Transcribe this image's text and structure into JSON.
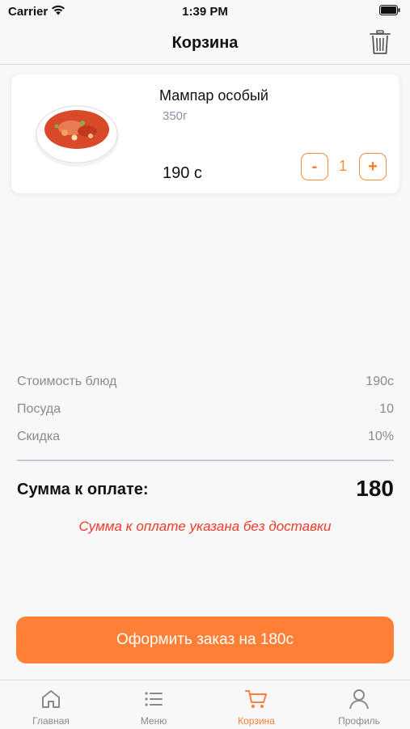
{
  "status_bar": {
    "carrier": "Carrier",
    "time": "1:39 PM"
  },
  "nav": {
    "title": "Корзина",
    "trash_icon": "trash-icon"
  },
  "cart_items": [
    {
      "name": "Мампар особый",
      "weight": "350г",
      "price": "190 с",
      "quantity": "1",
      "minus_label": "-",
      "plus_label": "+"
    }
  ],
  "summary": {
    "rows": [
      {
        "label": "Стоимость блюд",
        "value": "190с"
      },
      {
        "label": "Посуда",
        "value": "10"
      },
      {
        "label": "Скидка",
        "value": "10%"
      }
    ],
    "total_label": "Сумма к оплате:",
    "total_value": "180",
    "note": "Сумма к оплате указана без доставки"
  },
  "order_button": {
    "label": "Оформить заказ на 180с"
  },
  "tabs": [
    {
      "label": "Главная",
      "icon": "home-icon",
      "active": false
    },
    {
      "label": "Меню",
      "icon": "list-icon",
      "active": false
    },
    {
      "label": "Корзина",
      "icon": "cart-icon",
      "active": true
    },
    {
      "label": "Профиль",
      "icon": "profile-icon",
      "active": false
    }
  ],
  "colors": {
    "accent": "#ff7f36",
    "warning": "#f03a2a",
    "muted": "#8a8a8a"
  }
}
